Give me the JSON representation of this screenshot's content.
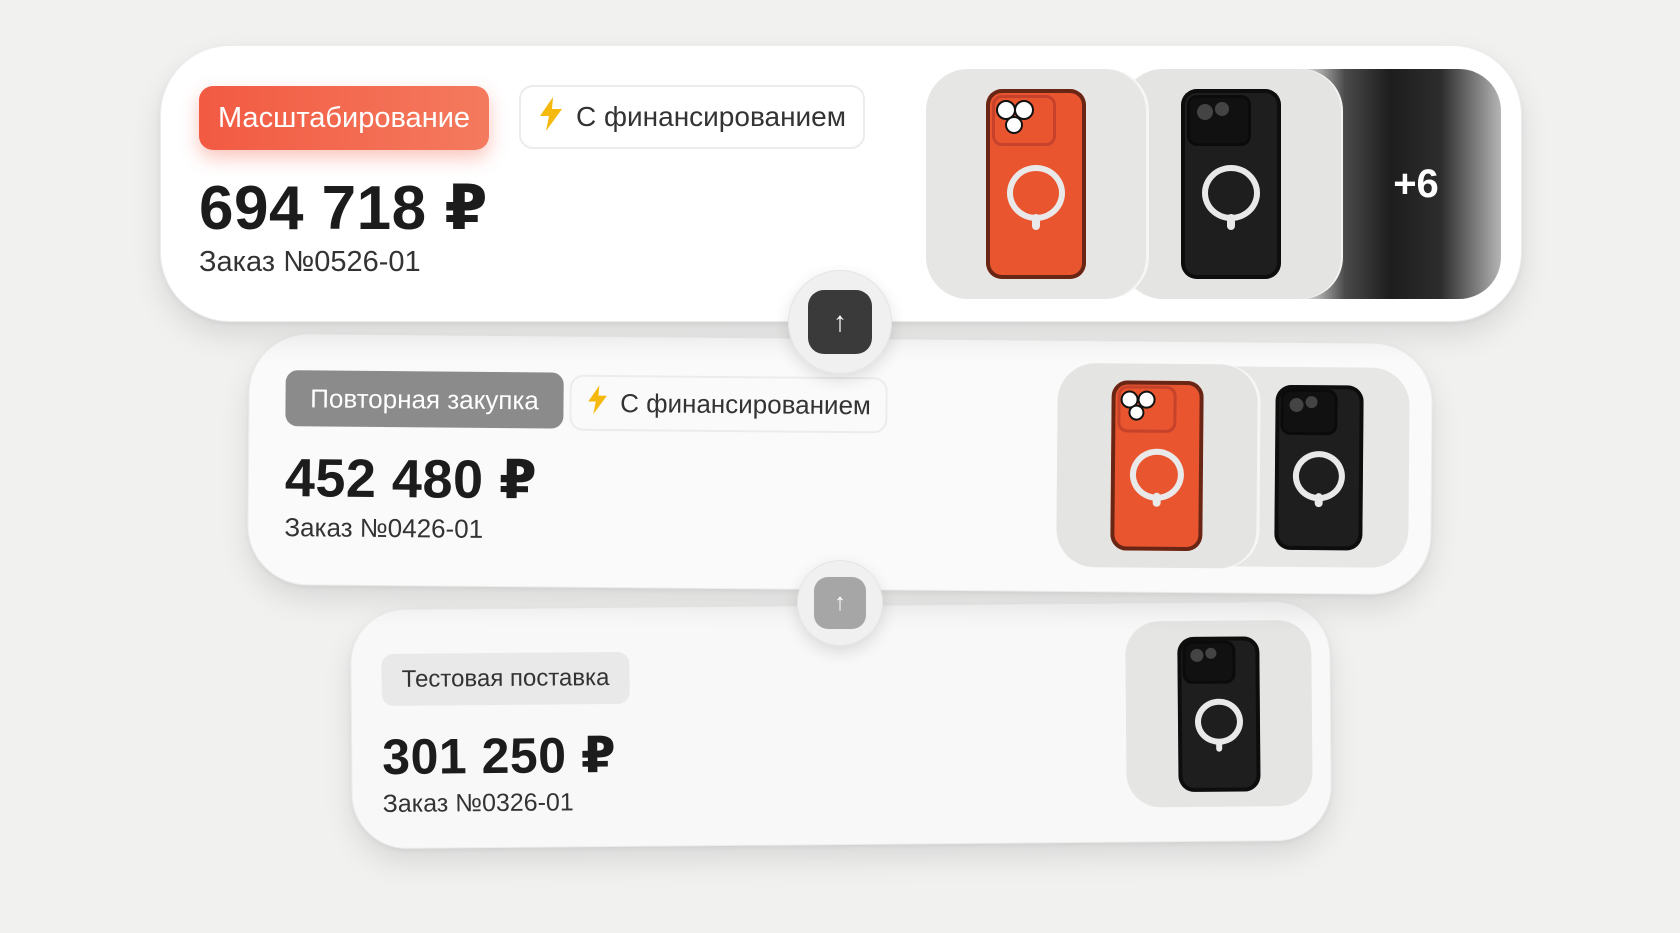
{
  "orders": [
    {
      "tag": "Масштабирование",
      "financing": "С финансированием",
      "financing_icon": "lightning-icon",
      "price": "694 718 ₽",
      "order": "Заказ №0526-01",
      "thumbnails": [
        "orange-phone-case",
        "black-phone-case"
      ],
      "more_count": "+6"
    },
    {
      "tag": "Повторная закупка",
      "financing": "С финансированием",
      "financing_icon": "lightning-icon",
      "price": "452 480 ₽",
      "order": "Заказ №0426-01",
      "thumbnails": [
        "orange-phone-case",
        "black-phone-case"
      ]
    },
    {
      "tag": "Тестовая поставка",
      "price": "301 250 ₽",
      "order": "Заказ №0326-01",
      "thumbnails": [
        "black-phone-case"
      ]
    }
  ],
  "connectors": [
    {
      "icon": "arrow-up-icon",
      "glyph": "↑",
      "color": "#3a3a3a"
    },
    {
      "icon": "arrow-up-icon",
      "glyph": "↑",
      "color": "#a6a6a6"
    }
  ],
  "colors": {
    "accent": "#f25a42",
    "bolt": "#f5b80d",
    "phone_orange": "#e9552f",
    "phone_black": "#1e1e1e"
  }
}
